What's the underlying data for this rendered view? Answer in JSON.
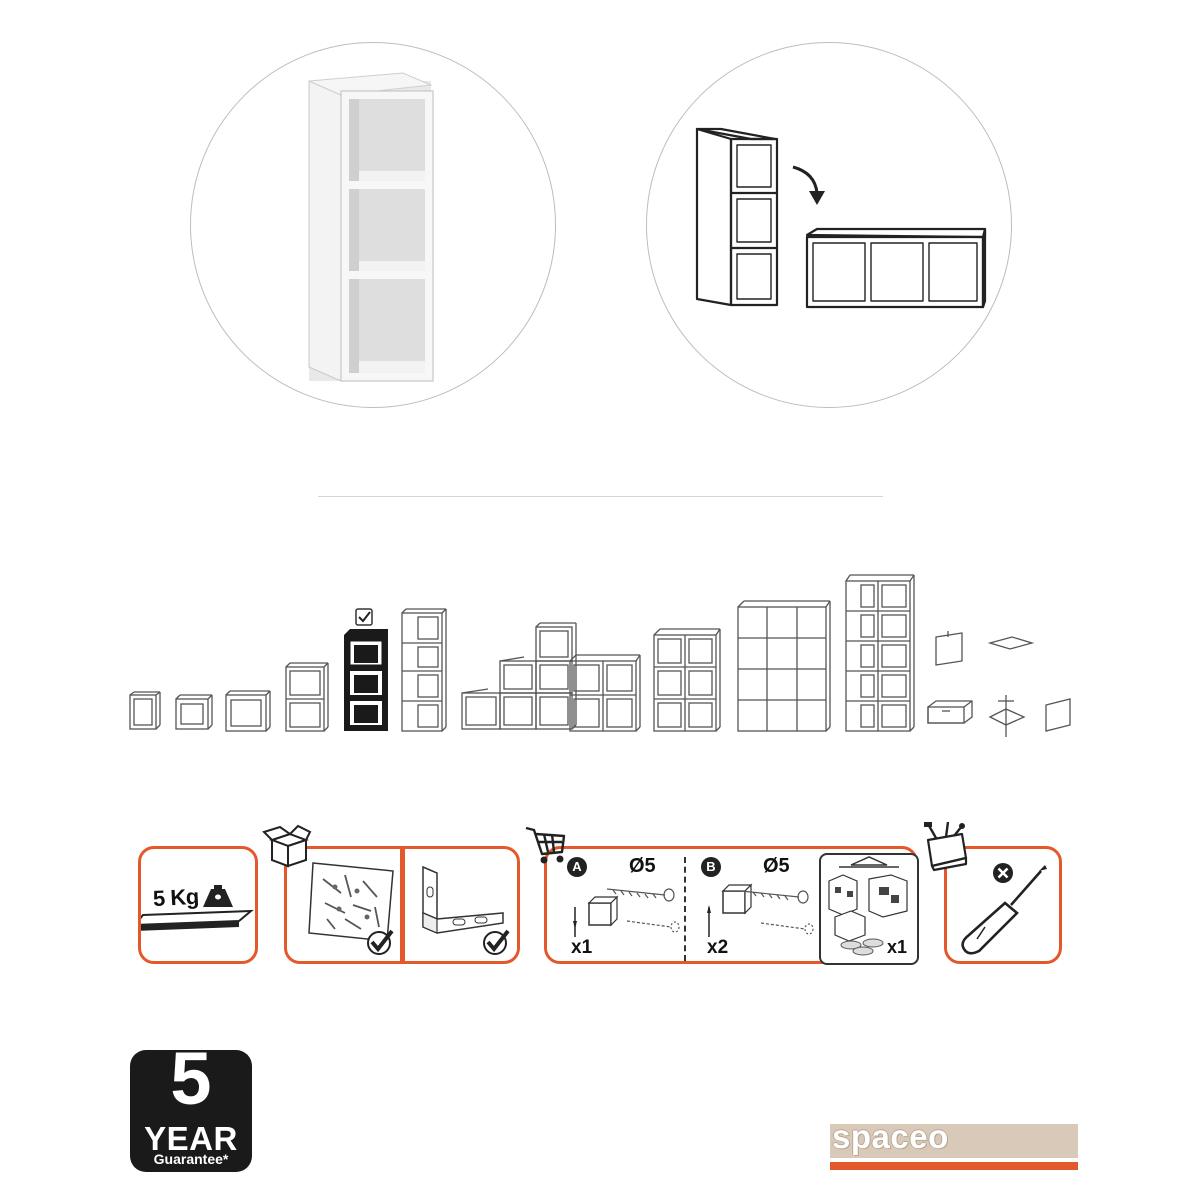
{
  "product_views": {
    "left": "shelf-unit-photo",
    "right": "vertical-to-horizontal-orientation"
  },
  "range": {
    "selected_index": 4,
    "selected_icon": "checkmark-icon"
  },
  "panels": {
    "weight": {
      "value": "5 Kg",
      "icon": "weight-icon"
    },
    "in_box_icon": "open-box-icon",
    "shop_icon": "shopping-cart-icon",
    "wall_fix": {
      "a": {
        "badge": "A",
        "diameter": "Ø5",
        "qty": "x1"
      },
      "b": {
        "badge": "B",
        "diameter": "Ø5",
        "qty": "x2"
      },
      "kit_qty": "x1"
    },
    "tools_icon": "toolbox-icon",
    "tool": "screwdriver-icon",
    "accent": "#e3592b"
  },
  "warranty": {
    "number": "5",
    "year": "YEAR",
    "guarantee": "Guarantee*"
  },
  "brand": {
    "name": "spaceo",
    "bg": "#d9c9b8",
    "stripe": "#e3592b"
  }
}
